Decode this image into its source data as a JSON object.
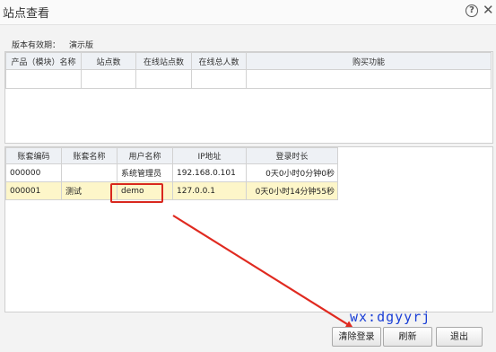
{
  "window": {
    "title": "站点查看",
    "help_icon": "question-icon",
    "close_icon": "close-icon"
  },
  "version": {
    "label": "版本有效期：",
    "value": "演示版"
  },
  "modules_table": {
    "headers": [
      "产品（模块）名称",
      "站点数",
      "在线站点数",
      "在线总人数",
      "购买功能"
    ],
    "rows": [
      [
        "",
        "",
        "",
        "",
        ""
      ]
    ]
  },
  "accounts_table": {
    "headers": [
      "账套编码",
      "账套名称",
      "用户名称",
      "IP地址",
      "登录时长"
    ],
    "rows": [
      [
        "000000",
        "",
        "系统管理员",
        "192.168.0.101",
        "0天0小时0分钟0秒"
      ],
      [
        "000001",
        "测试",
        "demo",
        "127.0.0.1",
        "0天0小时14分钟55秒"
      ]
    ],
    "selected_row": 1
  },
  "watermark": "wx:dgyyrj",
  "buttons": {
    "clear_login": "清除登录",
    "refresh": "刷新",
    "exit": "退出"
  },
  "colors": {
    "annotation_red": "#d9281e",
    "watermark_blue": "#1a3fd6",
    "selected_row": "#fdf6c9"
  }
}
